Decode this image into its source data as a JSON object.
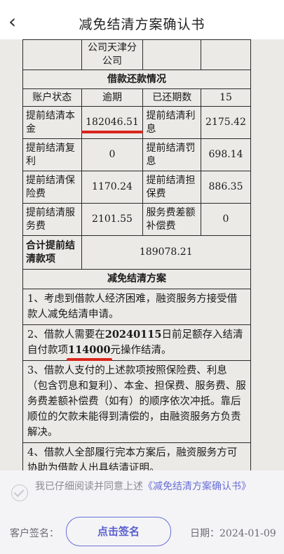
{
  "header": {
    "title": "减免结清方案确认书"
  },
  "table": {
    "partial_top": "公司天津分公司",
    "repayment_section": "借款还款情况",
    "rows": [
      {
        "l1": "账户状态",
        "v1": "逾期",
        "l2": "已还期数",
        "v2": "15"
      },
      {
        "l1": "提前结清本金",
        "v1": "182046.51",
        "l2": "提前结清利息",
        "v2": "2175.42"
      },
      {
        "l1": "提前结清复利",
        "v1": "0",
        "l2": "提前结清罚息",
        "v2": "698.14"
      },
      {
        "l1": "提前结清保险费",
        "v1": "1170.24",
        "l2": "提前结清担保费",
        "v2": "886.35"
      },
      {
        "l1": "提前结清服务费",
        "v1": "2101.55",
        "l2": "服务费差额补偿费",
        "v2": "0"
      }
    ],
    "total_label": "合计提前结清款项",
    "total_value": "189078.21",
    "plan_section": "减免结清方案",
    "plan_items": {
      "p1": "1、考虑到借款人经济困难，融资服务方接受借款人减免结清申请。",
      "p2_a": "2、借款人需要在",
      "p2_date": "20240115",
      "p2_b": "日前足额存入结清自付款项",
      "p2_amount": "114000",
      "p2_c": "元操作结清。",
      "p3": "3、借款人支付的上述款项按照保险费、利息（包含罚息和复利）、本金、担保费、服务费、服务费差额补偿费（如有）的顺序依次冲抵。靠后顺位的欠款未能得到清偿的，由融资服务方负责解决。",
      "p4": "4、借款人全部履行完本方案后，融资服务方可协助为借款人出具结清证明。"
    }
  },
  "agreement": {
    "text": "我已仔细阅读并同意上述",
    "link": "《减免结清方案确认书》"
  },
  "sign": {
    "label": "客户签名：",
    "button": "点击签名",
    "date_label": "日期：",
    "date_value": "2024-01-09"
  }
}
